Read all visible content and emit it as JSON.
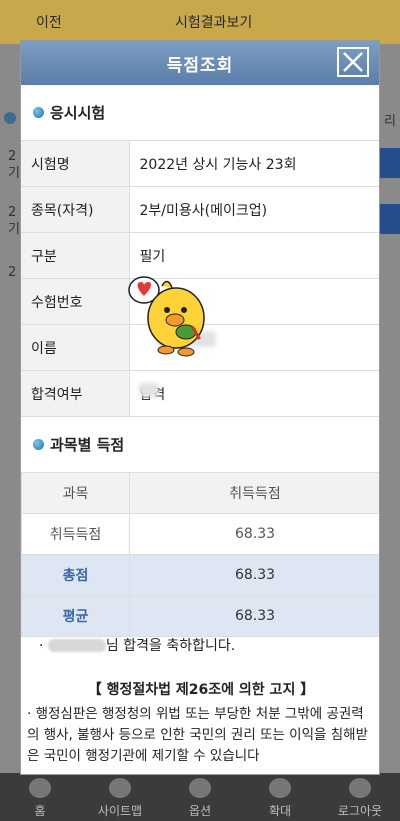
{
  "background": {
    "prev_label": "이전",
    "title": "시험결과보기",
    "col_tail": "리",
    "rows": [
      "2\n기",
      "2\n기",
      "2"
    ]
  },
  "modal": {
    "title": "득점조회",
    "section1_title": "응시시험",
    "info_rows": [
      {
        "label": "시험명",
        "value": "2022년 상시 기능사 23회"
      },
      {
        "label": "종목(자격)",
        "value": "2부/미용사(메이크업)"
      },
      {
        "label": "구분",
        "value": "필기"
      },
      {
        "label": "수험번호",
        "value": ""
      },
      {
        "label": "이름",
        "value": ""
      },
      {
        "label": "합격여부",
        "value": "합격"
      }
    ],
    "section2_title": "과목별 득점",
    "score_header": {
      "col1": "과목",
      "col2": "취득득점"
    },
    "score_rows": [
      {
        "label": "취득득점",
        "value": "68.33"
      },
      {
        "label": "총점",
        "value": "68.33"
      },
      {
        "label": "평균",
        "value": "68.33"
      }
    ],
    "congrats_text": "님 합격을 축하합니다.",
    "notice_title": "【 행정절차법 제26조에 의한 고지 】",
    "notice_body": "행정심판은 행정청의 위법 또는 부당한 처분 그밖에 공권력의 행사, 불행사 등으로 인한 국민의 권리 또는 이익을 침해받은 국민이 행정기관에 제기할 수 있습니다"
  },
  "bottom_nav": [
    {
      "label": "홈",
      "icon": "home-icon"
    },
    {
      "label": "사이트맵",
      "icon": "globe-icon"
    },
    {
      "label": "옵션",
      "icon": "settings-icon"
    },
    {
      "label": "확대",
      "icon": "zoom-in-icon"
    },
    {
      "label": "로그아웃",
      "icon": "logout-icon"
    }
  ]
}
